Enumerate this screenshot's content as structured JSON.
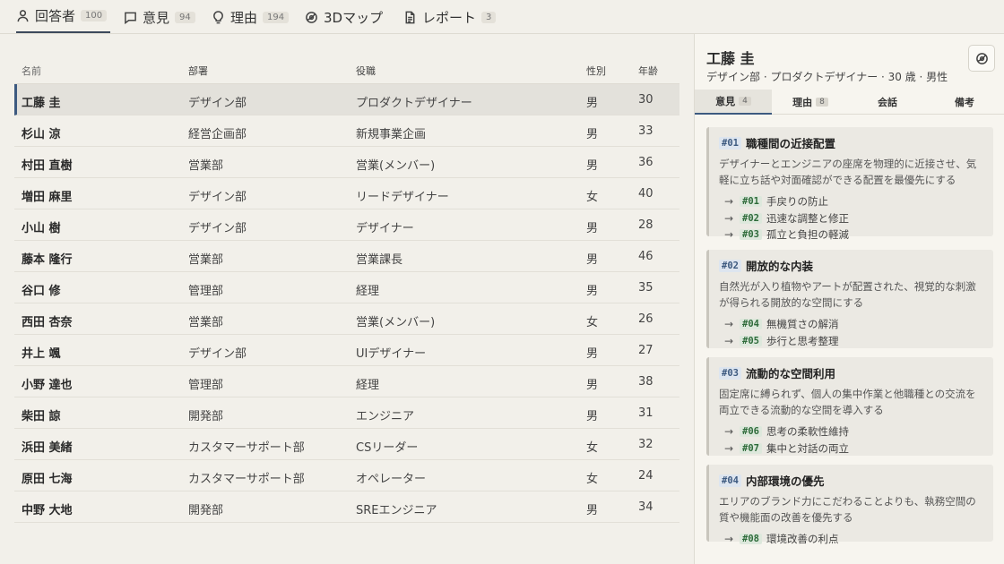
{
  "tabs": [
    {
      "label": "回答者",
      "count": "100",
      "icon": "person-icon"
    },
    {
      "label": "意見",
      "count": "94",
      "icon": "chat-icon"
    },
    {
      "label": "理由",
      "count": "194",
      "icon": "lightbulb-icon"
    },
    {
      "label": "3Dマップ",
      "count": "",
      "icon": "orbit-icon"
    },
    {
      "label": "レポート",
      "count": "3",
      "icon": "document-icon"
    }
  ],
  "table": {
    "headers": [
      "名前",
      "部署",
      "役職",
      "性別",
      "年齢"
    ],
    "rows": [
      {
        "name": "工藤 圭",
        "dept": "デザイン部",
        "role": "プロダクトデザイナー",
        "gender": "男",
        "age": "30"
      },
      {
        "name": "杉山 涼",
        "dept": "経営企画部",
        "role": "新規事業企画",
        "gender": "男",
        "age": "33"
      },
      {
        "name": "村田 直樹",
        "dept": "営業部",
        "role": "営業(メンバー)",
        "gender": "男",
        "age": "36"
      },
      {
        "name": "増田 麻里",
        "dept": "デザイン部",
        "role": "リードデザイナー",
        "gender": "女",
        "age": "40"
      },
      {
        "name": "小山 樹",
        "dept": "デザイン部",
        "role": "デザイナー",
        "gender": "男",
        "age": "28"
      },
      {
        "name": "藤本 隆行",
        "dept": "営業部",
        "role": "営業課長",
        "gender": "男",
        "age": "46"
      },
      {
        "name": "谷口 修",
        "dept": "管理部",
        "role": "経理",
        "gender": "男",
        "age": "35"
      },
      {
        "name": "西田 杏奈",
        "dept": "営業部",
        "role": "営業(メンバー)",
        "gender": "女",
        "age": "26"
      },
      {
        "name": "井上 颯",
        "dept": "デザイン部",
        "role": "UIデザイナー",
        "gender": "男",
        "age": "27"
      },
      {
        "name": "小野 達也",
        "dept": "管理部",
        "role": "経理",
        "gender": "男",
        "age": "38"
      },
      {
        "name": "柴田 諒",
        "dept": "開発部",
        "role": "エンジニア",
        "gender": "男",
        "age": "31"
      },
      {
        "name": "浜田 美緒",
        "dept": "カスタマーサポート部",
        "role": "CSリーダー",
        "gender": "女",
        "age": "32"
      },
      {
        "name": "原田 七海",
        "dept": "カスタマーサポート部",
        "role": "オペレーター",
        "gender": "女",
        "age": "24"
      },
      {
        "name": "中野 大地",
        "dept": "開発部",
        "role": "SREエンジニア",
        "gender": "男",
        "age": "34"
      }
    ]
  },
  "panel": {
    "name": "工藤 圭",
    "subtitle": "デザイン部 · プロダクトデザイナー · 30 歳 · 男性",
    "tabs": [
      {
        "label": "意見",
        "count": "4"
      },
      {
        "label": "理由",
        "count": "8"
      },
      {
        "label": "会話",
        "count": ""
      },
      {
        "label": "備考",
        "count": ""
      }
    ],
    "opinions": [
      {
        "id": "#01",
        "title": "職種間の近接配置",
        "desc": "デザイナーとエンジニアの座席を物理的に近接させ、気軽に立ち話や対面確認ができる配置を最優先にする",
        "reasons": [
          {
            "id": "#01",
            "text": "手戻りの防止"
          },
          {
            "id": "#02",
            "text": "迅速な調整と修正"
          },
          {
            "id": "#03",
            "text": "孤立と負担の軽減"
          }
        ]
      },
      {
        "id": "#02",
        "title": "開放的な内装",
        "desc": "自然光が入り植物やアートが配置された、視覚的な刺激が得られる開放的な空間にする",
        "reasons": [
          {
            "id": "#04",
            "text": "無機質さの解消"
          },
          {
            "id": "#05",
            "text": "歩行と思考整理"
          }
        ]
      },
      {
        "id": "#03",
        "title": "流動的な空間利用",
        "desc": "固定席に縛られず、個人の集中作業と他職種との交流を両立できる流動的な空間を導入する",
        "reasons": [
          {
            "id": "#06",
            "text": "思考の柔軟性維持"
          },
          {
            "id": "#07",
            "text": "集中と対話の両立"
          }
        ]
      },
      {
        "id": "#04",
        "title": "内部環境の優先",
        "desc": "エリアのブランド力にこだわることよりも、執務空間の質や機能面の改善を優先する",
        "reasons": [
          {
            "id": "#08",
            "text": "環境改善の利点"
          }
        ]
      }
    ]
  }
}
